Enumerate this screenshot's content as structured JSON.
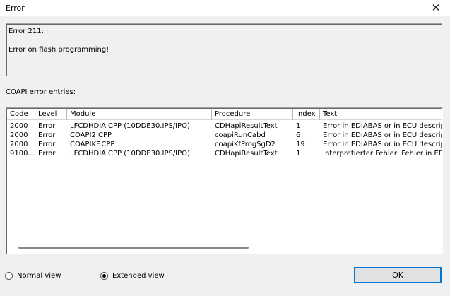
{
  "window": {
    "title": "Error",
    "close_glyph": "✕"
  },
  "message": {
    "line1": "Error 211:",
    "line2": "Error on flash programming!"
  },
  "entries_label": "COAPI error entries:",
  "table": {
    "columns": [
      "Code",
      "Level",
      "Module",
      "Procedure",
      "Index",
      "Text"
    ],
    "rows": [
      [
        "2000",
        "Error",
        "LFCDHDIA.CPP (10DDE30.IPS/IPO)",
        "CDHapiResultText",
        "1",
        "Error in EDIABAS or in ECU description"
      ],
      [
        "2000",
        "Error",
        "COAPI2.CPP",
        "coapiRunCabd",
        "6",
        "Error in EDIABAS or in ECU description"
      ],
      [
        "2000",
        "Error",
        "COAPIKF.CPP",
        "coapiKfProgSgD2",
        "19",
        "Error in EDIABAS or in ECU description"
      ],
      [
        "9100...",
        "Error",
        "LFCDHDIA.CPP (10DDE30.IPS/IPO)",
        "CDHapiResultText",
        "1",
        "Interpretierter Fehler: Fehler in EDIABAS"
      ]
    ]
  },
  "view_options": {
    "normal": "Normal view",
    "extended": "Extended view",
    "selected": "extended"
  },
  "buttons": {
    "ok": "OK"
  }
}
